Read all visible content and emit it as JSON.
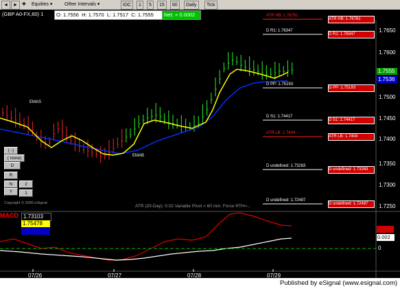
{
  "toolbar": {
    "equities_label": "Equities",
    "other_intervals_label": "Other Intervals",
    "intervals": [
      "IDC",
      "1",
      "5",
      "15",
      "60",
      "Daily",
      "Tick"
    ]
  },
  "title": {
    "symbol": "(GBP A0-FX,60) 1",
    "open": "O: 1.7556",
    "high": "H: 1.7570",
    "low": "L: 1.7517",
    "close": "C: 1.7555",
    "net": "Net: + 0.0002"
  },
  "price_axis": [
    "1.7650",
    "1.7600",
    "1.7550",
    "1.7500",
    "1.7450",
    "1.7400",
    "1.7350",
    "1.7300",
    "1.7250"
  ],
  "price_tags": {
    "last": "1.7555",
    "avg": "1.7536"
  },
  "pivot_levels": [
    {
      "left": "ATR HB: 1.76761",
      "right": "ATR HB: 1.76761",
      "color": "#ff2020"
    },
    {
      "left": "D R1: 1.76347",
      "right": "D R1: 1.76347",
      "color": "#ffffff"
    },
    {
      "left": "D PP: 1.75193",
      "right": "D PP: 1.75193",
      "color": "#ffffff"
    },
    {
      "left": "D S1: 1.74417",
      "right": "D S1: 1.74417",
      "color": "#ffffff"
    },
    {
      "left": "ATR LB: 1.7404",
      "right": "ATR LB: 1.7404",
      "color": "#ff2020"
    },
    {
      "left": "D undefined: 1.73263",
      "right": "D undefined: 1.73263",
      "color": "#ffffff"
    },
    {
      "left": "D undefined: 1.72487",
      "right": "D undefined: 1.72487",
      "color": "#ffffff"
    }
  ],
  "annotations": {
    "emas": "EMAS",
    "emab": "EMAB",
    "atr_info": "ATR (20-Day): 0.02    Variable Pivot = 60 min.    Force RTH=...",
    "copyright": "Copyright © 2005 eSignal"
  },
  "macd": {
    "label": "MACD",
    "values": [
      "1.73103",
      "1.75478",
      "1.75036"
    ],
    "value_colors": [
      "#ffffff",
      "#ffff00",
      "#0000c0"
    ],
    "axis_right_value": "0.002",
    "axis_zero": "0"
  },
  "dates": [
    "07/26",
    "07/27",
    "07/28",
    "07/29"
  ],
  "side_buttons": [
    "( -)",
    "( none)",
    "D",
    "R",
    "N",
    "Y",
    "1",
    "2"
  ],
  "footer_text": "Published by eSignal (www.esignal.com)"
}
